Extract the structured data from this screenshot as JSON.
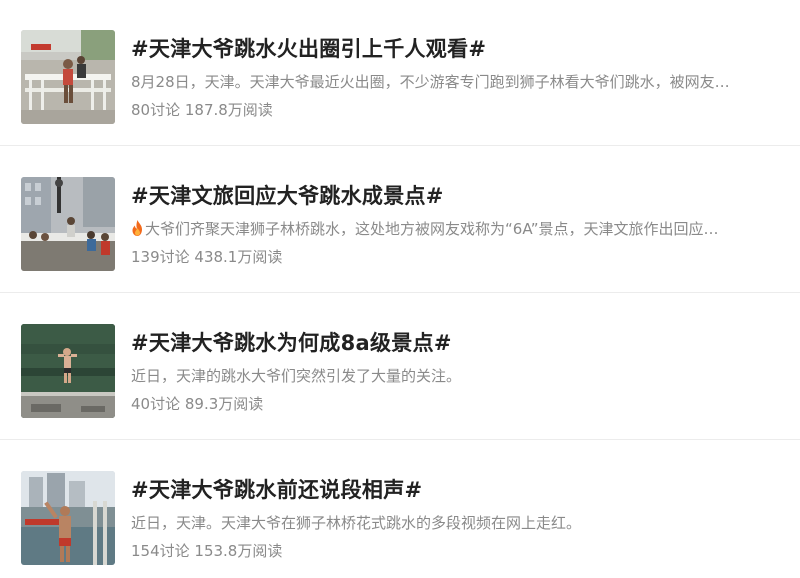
{
  "topics": [
    {
      "title": "#天津大爷跳水火出圈引上千人观看#",
      "description": "8月28日，天津。天津大爷最近火出圈，不少游客专门跑到狮子林看大爷们跳水，被网友…",
      "stats": "80讨论 187.8万阅读",
      "thumbnail": "bridge-crowd-photo"
    },
    {
      "title": "#天津文旅回应大爷跳水成景点#",
      "description": "大爷们齐聚天津狮子林桥跳水，这处地方被网友戏称为“6A”景点，天津文旅作出回应…",
      "stats": "139讨论 438.1万阅读",
      "thumbnail": "crowd-on-bridge-photo",
      "badge_icon": "fire-icon"
    },
    {
      "title": "#天津大爷跳水为何成8a级景点#",
      "description": "近日，天津的跳水大爷们突然引发了大量的关注。",
      "stats": "40讨论 89.3万阅读",
      "thumbnail": "diver-in-air-photo"
    },
    {
      "title": "#天津大爷跳水前还说段相声#",
      "description": "近日，天津。天津大爷在狮子林桥花式跳水的多段视频在网上走红。",
      "stats": "154讨论 153.8万阅读",
      "thumbnail": "man-waving-photo"
    }
  ],
  "colors": {
    "title": "#222222",
    "meta": "#8a8a8a",
    "divider": "#ececec",
    "fire": "#f26a1b"
  }
}
